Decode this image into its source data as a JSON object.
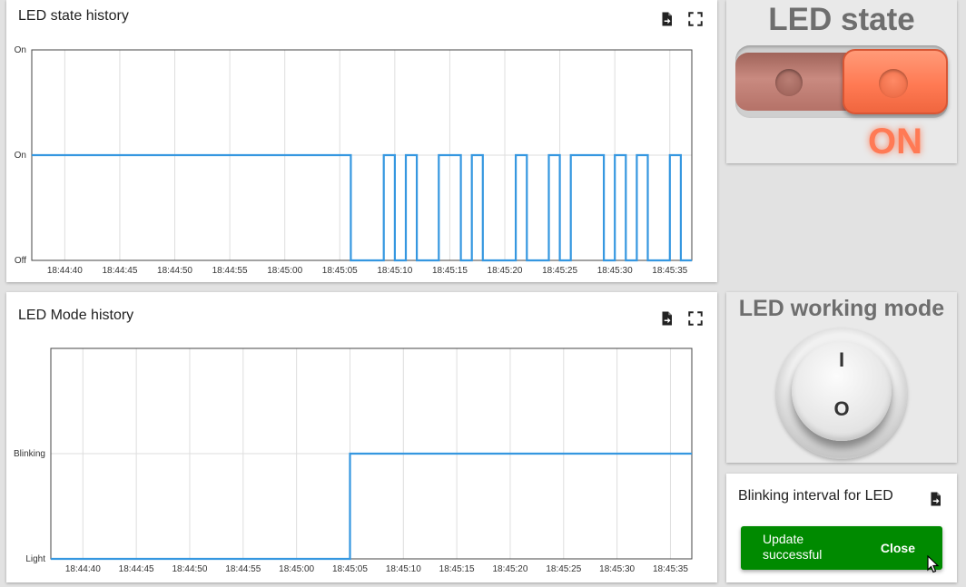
{
  "led_state_history": {
    "title": "LED state history",
    "icons": [
      "export-icon",
      "fullscreen-icon"
    ],
    "chart_data": {
      "type": "line",
      "step": true,
      "y_categories": [
        "Off",
        "On",
        "On"
      ],
      "y_tick_labels": [
        "On",
        "On",
        "Off"
      ],
      "x_tick_labels": [
        "18:44:40",
        "18:44:45",
        "18:44:50",
        "18:44:55",
        "18:45:00",
        "18:45:05",
        "18:45:10",
        "18:45:15",
        "18:45:20",
        "18:45:25",
        "18:45:30",
        "18:45:35"
      ],
      "x_start": "18:44:37",
      "x_end": "18:45:37",
      "series": [
        {
          "color": "#3597e0",
          "points": [
            [
              "18:44:37",
              1
            ],
            [
              "18:45:06",
              1
            ],
            [
              "18:45:06",
              0
            ],
            [
              "18:45:09",
              0
            ],
            [
              "18:45:09",
              1
            ],
            [
              "18:45:10",
              1
            ],
            [
              "18:45:10",
              0
            ],
            [
              "18:45:11",
              0
            ],
            [
              "18:45:11",
              1
            ],
            [
              "18:45:12",
              1
            ],
            [
              "18:45:12",
              0
            ],
            [
              "18:45:14",
              0
            ],
            [
              "18:45:14",
              1
            ],
            [
              "18:45:16",
              1
            ],
            [
              "18:45:16",
              0
            ],
            [
              "18:45:17",
              0
            ],
            [
              "18:45:17",
              1
            ],
            [
              "18:45:18",
              1
            ],
            [
              "18:45:18",
              0
            ],
            [
              "18:45:21",
              0
            ],
            [
              "18:45:21",
              1
            ],
            [
              "18:45:22",
              1
            ],
            [
              "18:45:22",
              0
            ],
            [
              "18:45:24",
              0
            ],
            [
              "18:45:24",
              1
            ],
            [
              "18:45:25",
              1
            ],
            [
              "18:45:25",
              0
            ],
            [
              "18:45:26",
              0
            ],
            [
              "18:45:26",
              1
            ],
            [
              "18:45:29",
              1
            ],
            [
              "18:45:29",
              0
            ],
            [
              "18:45:30",
              0
            ],
            [
              "18:45:30",
              1
            ],
            [
              "18:45:31",
              1
            ],
            [
              "18:45:31",
              0
            ],
            [
              "18:45:32",
              0
            ],
            [
              "18:45:32",
              1
            ],
            [
              "18:45:33",
              1
            ],
            [
              "18:45:33",
              0
            ],
            [
              "18:45:35",
              0
            ],
            [
              "18:45:35",
              1
            ],
            [
              "18:45:36",
              1
            ],
            [
              "18:45:36",
              0
            ],
            [
              "18:45:37",
              0
            ]
          ]
        }
      ]
    }
  },
  "led_mode_history": {
    "title": "LED Mode history",
    "icons": [
      "export-icon",
      "fullscreen-icon"
    ],
    "chart_data": {
      "type": "line",
      "step": true,
      "y_categories": [
        "Light",
        "Blinking"
      ],
      "x_tick_labels": [
        "18:44:40",
        "18:44:45",
        "18:44:50",
        "18:44:55",
        "18:45:00",
        "18:45:05",
        "18:45:10",
        "18:45:15",
        "18:45:20",
        "18:45:25",
        "18:45:30",
        "18:45:35"
      ],
      "x_start": "18:44:37",
      "x_end": "18:45:37",
      "series": [
        {
          "color": "#3597e0",
          "points": [
            [
              "18:44:37",
              0
            ],
            [
              "18:45:05",
              0
            ],
            [
              "18:45:05",
              1
            ],
            [
              "18:45:37",
              1
            ]
          ]
        }
      ]
    }
  },
  "led_state": {
    "title": "LED state",
    "value": "ON",
    "on_color": "#ff7a55"
  },
  "led_working_mode": {
    "title": "LED working mode",
    "mark_top": "I",
    "mark_bottom": "O"
  },
  "blinking_interval": {
    "title": "Blinking interval for LED",
    "toast_message": "Update successful",
    "toast_close": "Close",
    "toast_color": "#008a00"
  }
}
